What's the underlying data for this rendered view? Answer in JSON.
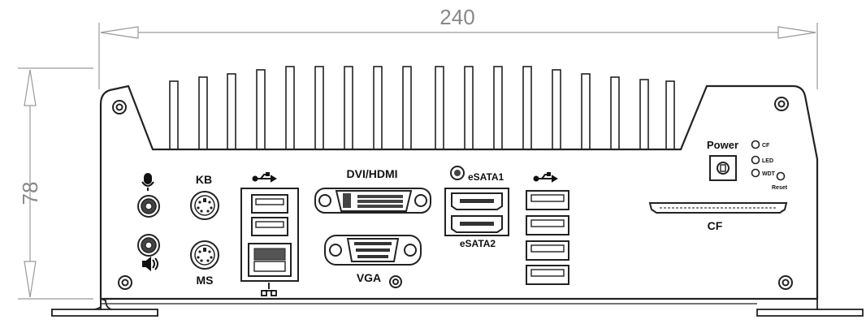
{
  "dimensions": {
    "width": "240",
    "height": "78"
  },
  "labels": {
    "kb": "KB",
    "ms": "MS",
    "dvi_hdmi": "DVI/HDMI",
    "vga": "VGA",
    "esata1": "eSATA1",
    "esata2": "eSATA2",
    "power": "Power",
    "led1": "CF",
    "led2": "LED",
    "led3": "WDT",
    "reset": "Reset",
    "cf": "CF"
  },
  "icons": {
    "microphone": "microphone-icon",
    "speaker": "speaker-icon",
    "usb": "usb-icon",
    "network": "network-icon"
  },
  "colors": {
    "line": "#222222",
    "dimension": "#999999",
    "background": "#ffffff"
  }
}
